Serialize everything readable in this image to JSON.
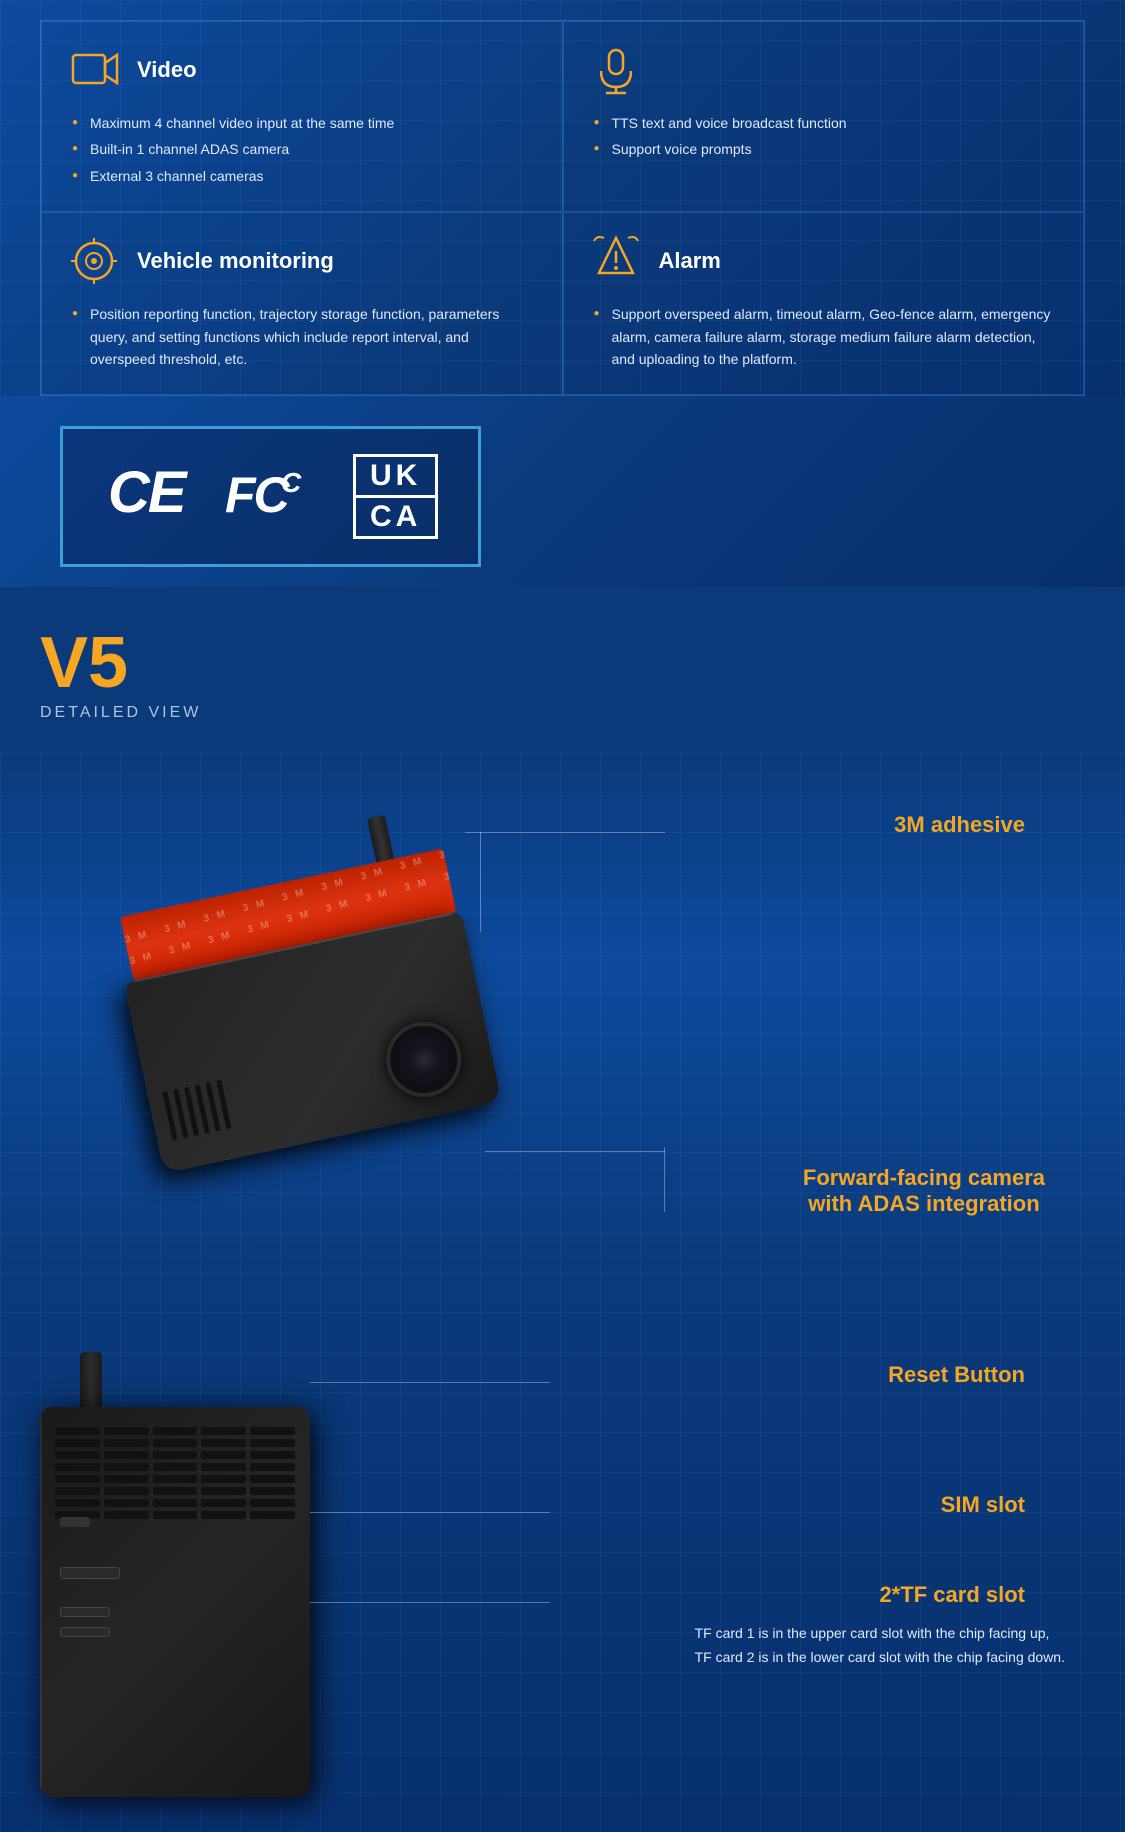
{
  "features": {
    "video": {
      "title": "Video",
      "bullets": [
        "Maximum 4 channel video input at the same time",
        "Built-in 1 channel ADAS camera",
        "External 3 channel cameras"
      ]
    },
    "voice": {
      "bullets": [
        "TTS text and voice broadcast function",
        "Support voice prompts"
      ]
    },
    "vehicle_monitoring": {
      "title": "Vehicle monitoring",
      "bullets": [
        "Position reporting function, trajectory storage function, parameters query, and setting functions which include report interval, and overspeed threshold, etc."
      ]
    },
    "alarm": {
      "title": "Alarm",
      "bullets": [
        "Support overspeed alarm, timeout alarm, Geo-fence alarm, emergency alarm, camera failure alarm, storage medium failure alarm detection, and uploading to the platform."
      ]
    }
  },
  "certifications": {
    "ce": "CE",
    "fcc": "FC",
    "ukca_top": "UK",
    "ukca_bottom": "CA"
  },
  "v5": {
    "title": "V5",
    "subtitle": "DETAILED VIEW"
  },
  "annotations": {
    "adhesive": "3M adhesive",
    "forward_camera_line1": "Forward-facing camera",
    "forward_camera_line2": "with ADAS integration",
    "reset": "Reset Button",
    "sim": "SIM slot",
    "tf_title": "2*TF card slot",
    "tf_desc1": "TF card 1 is in the upper card slot with the chip facing up,",
    "tf_desc2": "TF card 2 is in the lower card slot with the chip facing down."
  }
}
